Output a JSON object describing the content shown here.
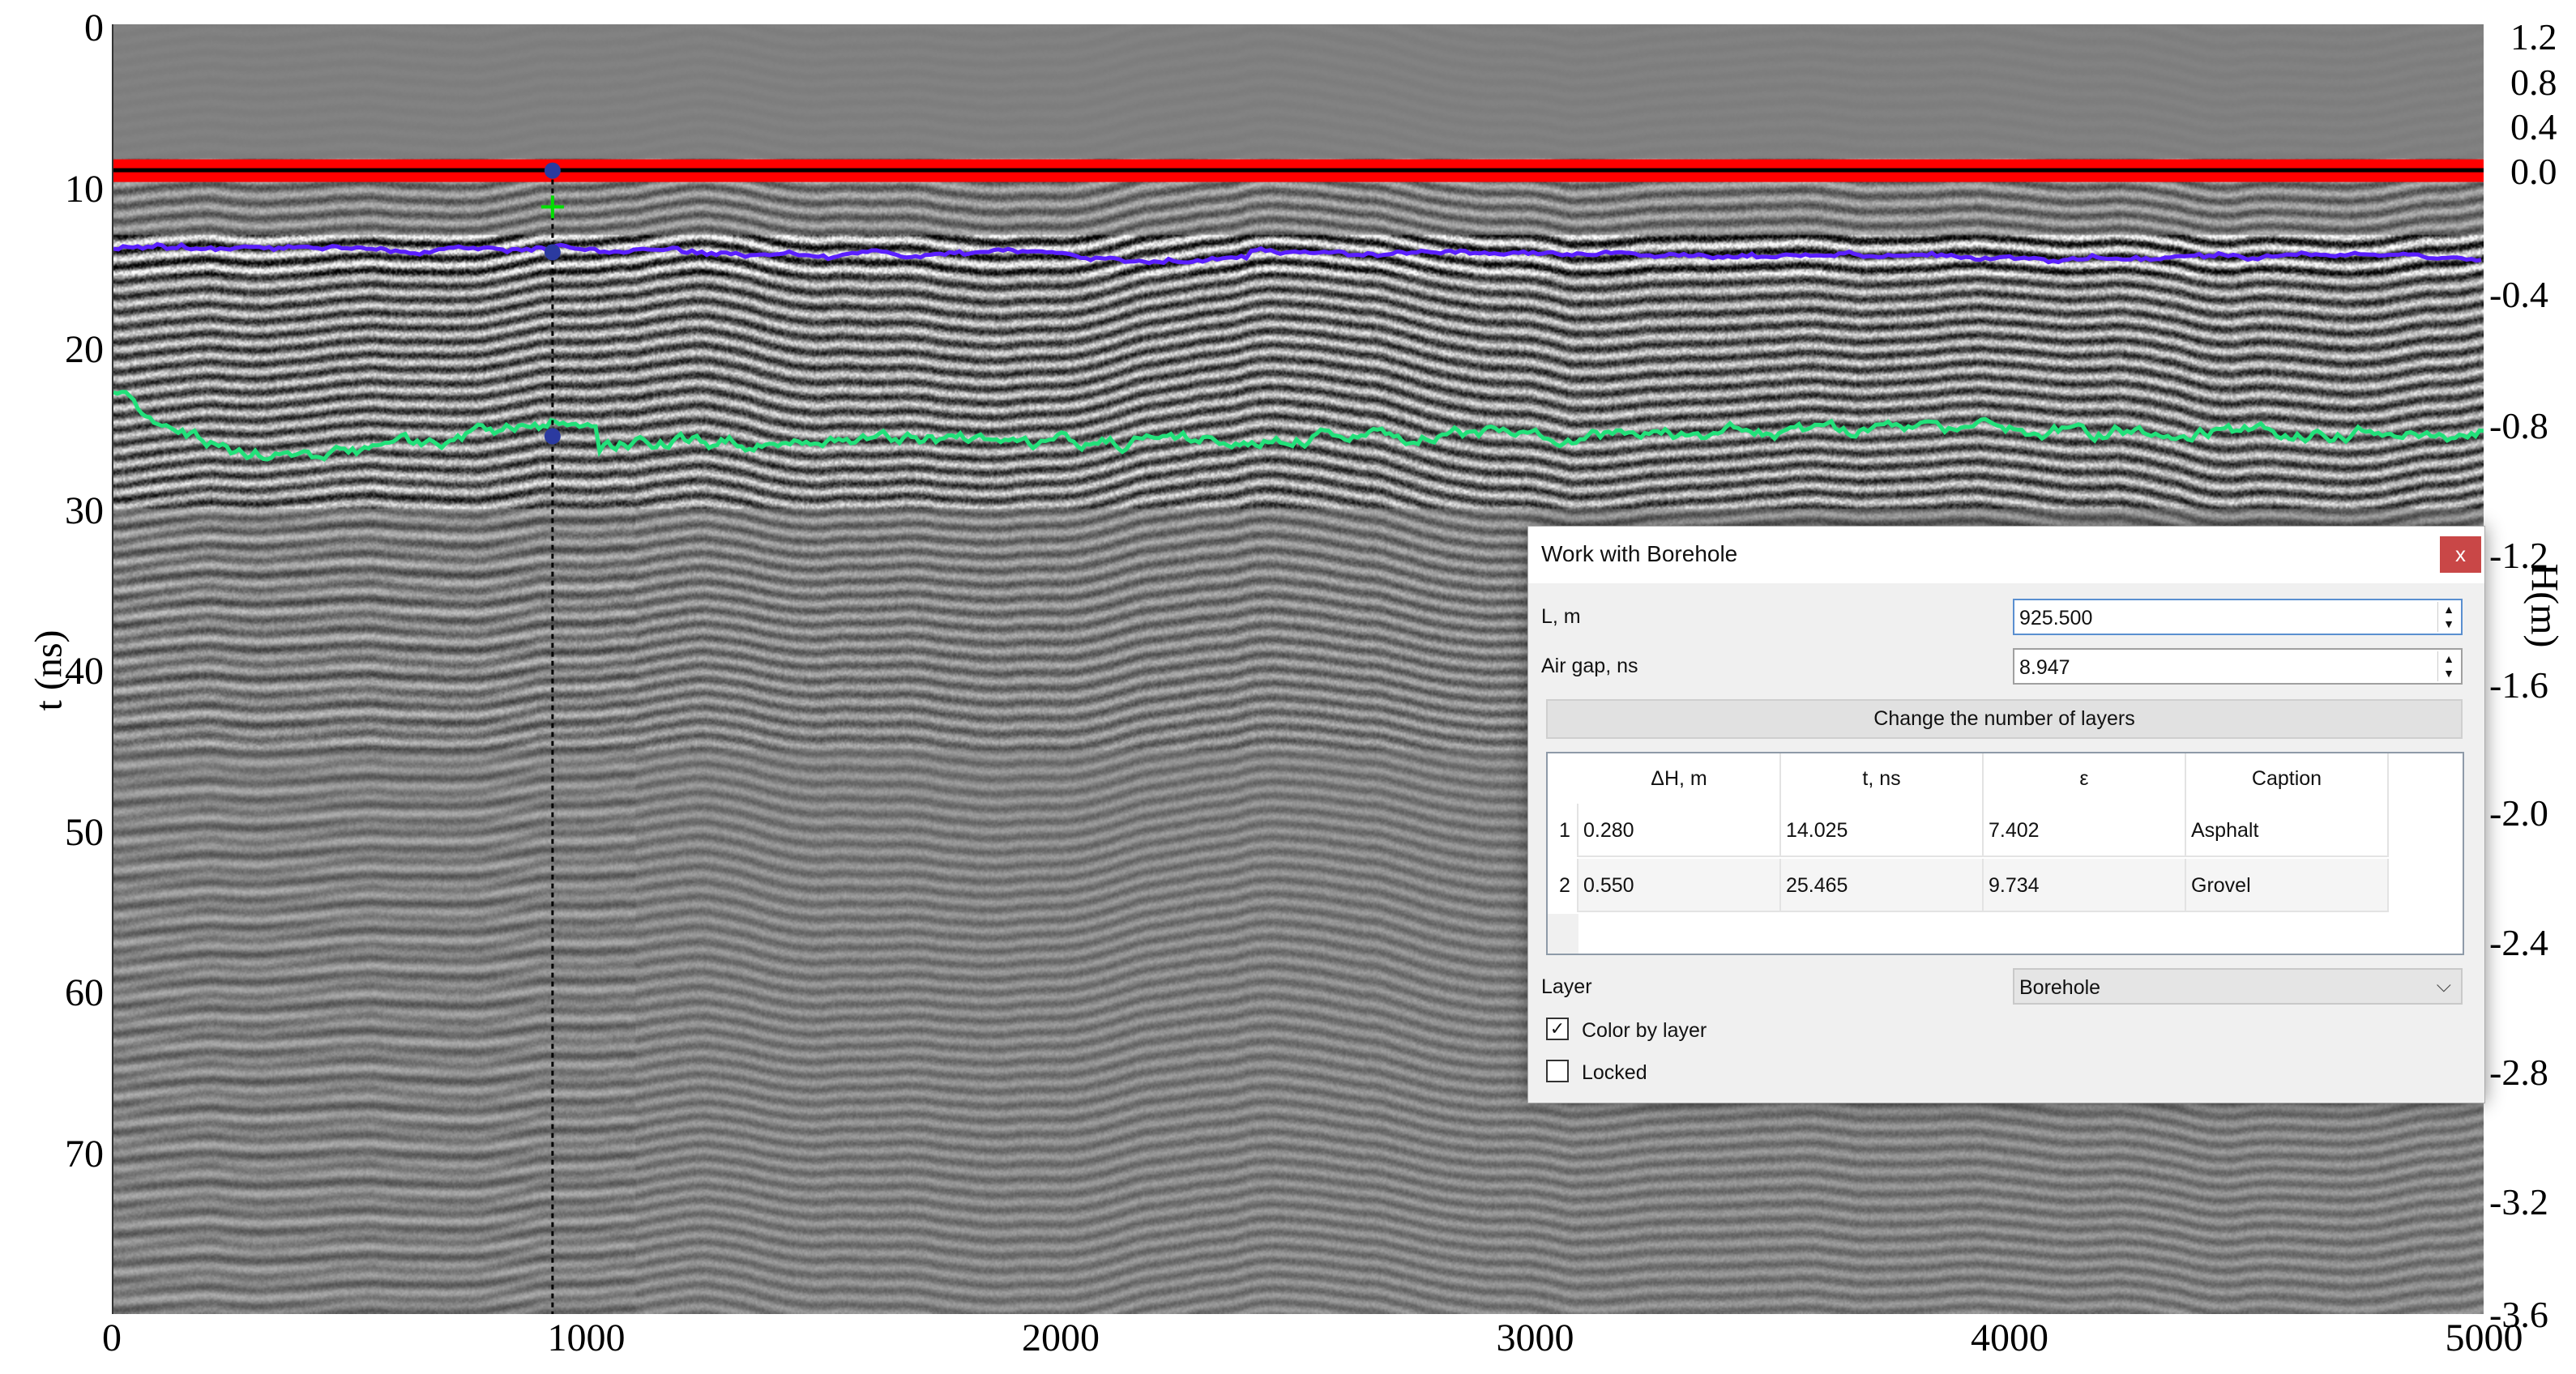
{
  "radargram": {
    "left_axis": {
      "label": "t (ns)",
      "ticks": [
        "0",
        "10",
        "20",
        "30",
        "40",
        "50",
        "60",
        "70"
      ],
      "range": [
        0,
        80
      ]
    },
    "right_axis": {
      "label": "H(m)",
      "ticks": [
        "1.2",
        "0.8",
        "0.4",
        "0.0",
        "-0.4",
        "-0.8",
        "-1.2",
        "-1.6",
        "-2.0",
        "-2.4",
        "-2.8",
        "-3.2",
        "-3.6"
      ]
    },
    "bottom_axis": {
      "ticks": [
        "0",
        "1000",
        "2000",
        "3000",
        "4000",
        "5000"
      ],
      "range": [
        0,
        5050
      ]
    },
    "borehole_position_m": 925.5,
    "horizons": [
      {
        "name": "air-gap",
        "color": "#ff0000",
        "t_ns": 8.947
      },
      {
        "name": "asphalt",
        "color": "#5a1fff",
        "t_ns": 14.025
      },
      {
        "name": "gravel",
        "color": "#22e07a",
        "t_ns": 25.465
      }
    ]
  },
  "dialog": {
    "title": "Work with Borehole",
    "close_label": "x",
    "l_label": "L, m",
    "l_value": "925.500",
    "airgap_label": "Air gap, ns",
    "airgap_value": "8.947",
    "change_layers_label": "Change the number of layers",
    "table": {
      "headers": [
        "ΔH, m",
        "t, ns",
        "ε",
        "Caption"
      ],
      "rows": [
        {
          "n": "1",
          "dh": "0.280",
          "t": "14.025",
          "eps": "7.402",
          "caption": "Asphalt"
        },
        {
          "n": "2",
          "dh": "0.550",
          "t": "25.465",
          "eps": "9.734",
          "caption": "Grovel"
        }
      ]
    },
    "layer_label": "Layer",
    "layer_value": "Borehole",
    "color_by_layer_label": "Color by layer",
    "color_by_layer_checked": true,
    "locked_label": "Locked",
    "locked_checked": false,
    "close_color": "#c94747"
  }
}
